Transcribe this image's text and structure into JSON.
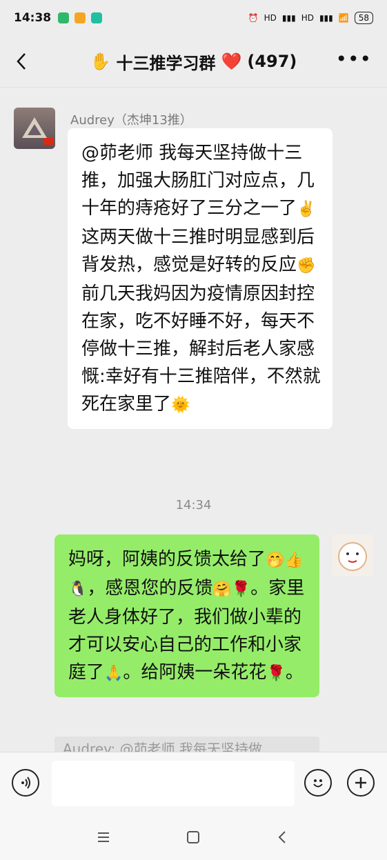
{
  "status_bar": {
    "time": "14:38",
    "battery": "58",
    "signal1": "HD",
    "signal2": "HD"
  },
  "header": {
    "title_emoji": "✋",
    "title": "十三推学习群",
    "heart": "❤️",
    "count": "(497)"
  },
  "messages": {
    "incoming": {
      "sender": "Audrey（杰坤13推）",
      "text": [
        {
          "t": "@茆老师  我每天坚持做十三推，加强大肠肛门对应点，几十年的痔疮好了三分之一了"
        },
        {
          "emoji": "✌️"
        },
        {
          "t": "这两天做十三推时明显感到后背发热，感觉是好转的反应"
        },
        {
          "emoji": "✊"
        },
        {
          "t": "前几天我妈因为疫情原因封控在家，吃不好睡不好，每天不停做十三推，解封后老人家感慨:幸好有十三推陪伴，不然就死在家里了"
        },
        {
          "emoji": "🌞"
        }
      ]
    },
    "timestamp": "14:34",
    "outgoing": {
      "text": [
        {
          "t": "妈呀，阿姨的反馈太给了"
        },
        {
          "emoji": "🤭"
        },
        {
          "emoji": "👍"
        },
        {
          "emoji": "🐧"
        },
        {
          "t": "，感恩您的反馈"
        },
        {
          "emoji": "🤗"
        },
        {
          "emoji": "🌹"
        },
        {
          "t": "。家里老人身体好了，我们做小辈的才可以安心自己的工作和小家庭了"
        },
        {
          "emoji": "🙏"
        },
        {
          "t": "。给阿姨一朵花花"
        },
        {
          "emoji": "🌹"
        },
        {
          "t": "。"
        }
      ]
    },
    "quote_preview": "Audrey: @茆老师 我每天坚持做"
  },
  "colors": {
    "background": "#ededed",
    "outgoing_bubble": "#95ec69",
    "incoming_bubble": "#ffffff"
  },
  "icons": {
    "back": "chevron-left-icon",
    "more": "more-icon",
    "voice": "voice-icon",
    "emoji": "emoji-icon",
    "plus": "plus-icon"
  }
}
